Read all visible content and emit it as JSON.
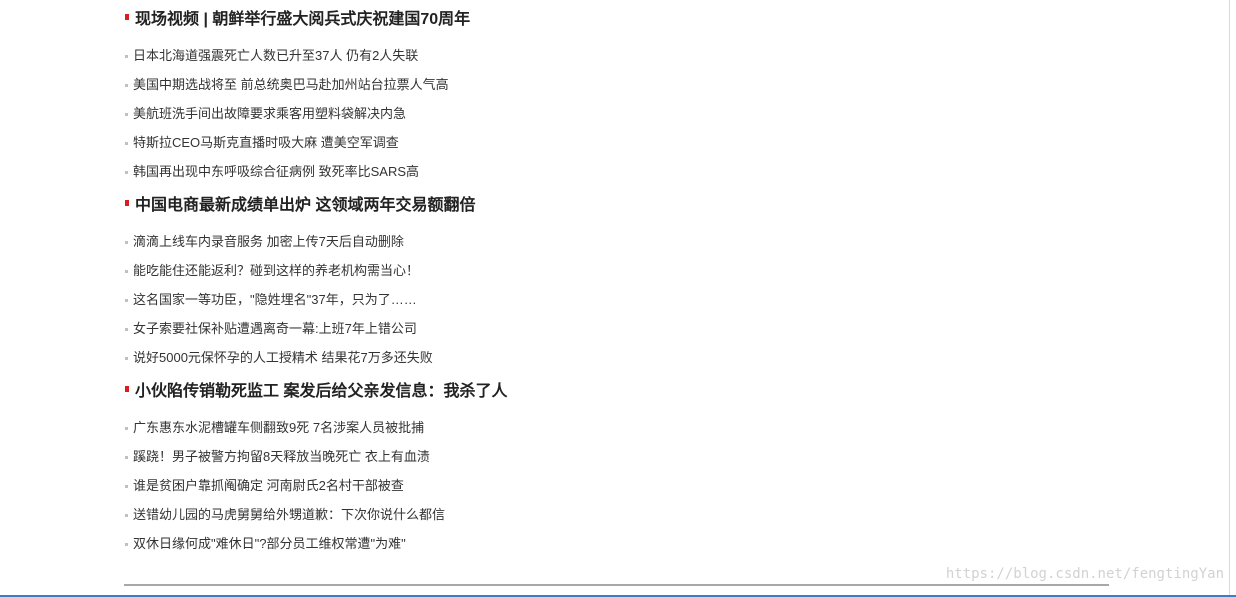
{
  "sections": [
    {
      "headline": "现场视频 | 朝鲜举行盛大阅兵式庆祝建国70周年",
      "items": [
        "日本北海道强震死亡人数已升至37人 仍有2人失联",
        "美国中期选战将至 前总统奥巴马赴加州站台拉票人气高",
        "美航班洗手间出故障要求乘客用塑料袋解决内急",
        "特斯拉CEO马斯克直播时吸大麻 遭美空军调查",
        "韩国再出现中东呼吸综合征病例 致死率比SARS高"
      ]
    },
    {
      "headline": "中国电商最新成绩单出炉 这领域两年交易额翻倍",
      "items": [
        "滴滴上线车内录音服务 加密上传7天后自动删除",
        "能吃能住还能返利？碰到这样的养老机构需当心！",
        "这名国家一等功臣，\"隐姓埋名\"37年，只为了……",
        "女子索要社保补贴遭遇离奇一幕:上班7年上错公司",
        "说好5000元保怀孕的人工授精术 结果花7万多还失败"
      ]
    },
    {
      "headline": "小伙陷传销勒死监工 案发后给父亲发信息：我杀了人",
      "items": [
        "广东惠东水泥槽罐车侧翻致9死 7名涉案人员被批捕",
        "蹊跷！男子被警方拘留8天释放当晚死亡 衣上有血渍",
        "谁是贫困户靠抓阄确定 河南尉氏2名村干部被查",
        "送错幼儿园的马虎舅舅给外甥道歉：下次你说什么都信",
        "双休日缘何成\"难休日\"?部分员工维权常遭\"为难\""
      ]
    }
  ],
  "watermark": "https://blog.csdn.net/fengtingYan",
  "colors": {
    "headline_mark": "#d81e1e",
    "headline_text": "#222222",
    "item_text": "#333333",
    "item_dot": "#c0c0c0",
    "bottom_rule": "#a8a8a8",
    "bottom_edge": "#3d7cc9"
  }
}
